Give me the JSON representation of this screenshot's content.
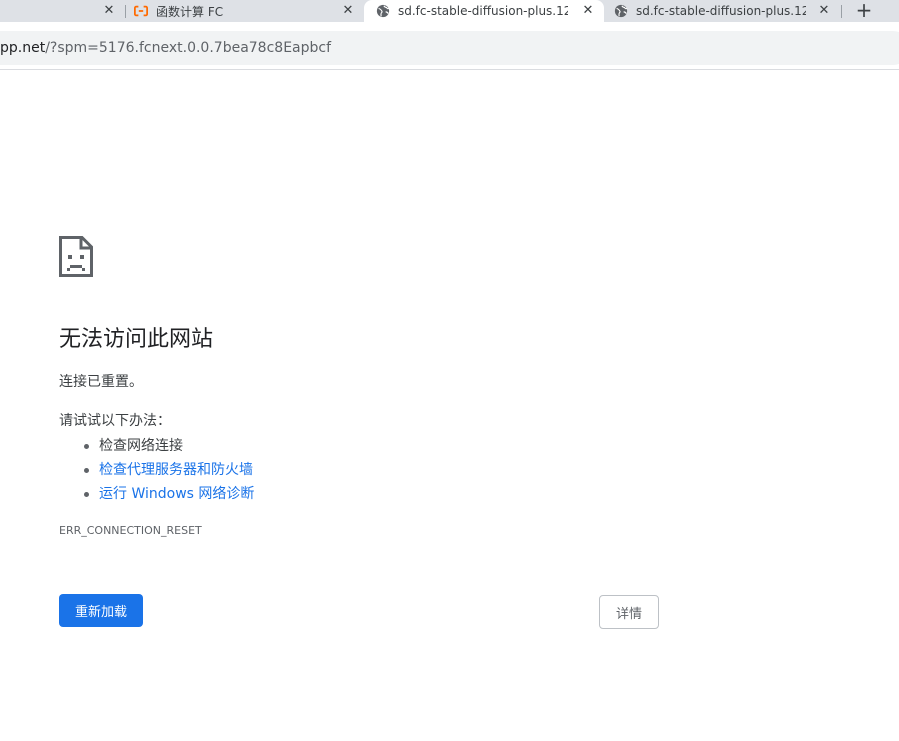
{
  "tabs": [
    {
      "title": "",
      "icon": "",
      "active": false
    },
    {
      "title": "函数计算 FC",
      "icon": "aliyun-logo-icon",
      "active": false
    },
    {
      "title": "sd.fc-stable-diffusion-plus.12",
      "icon": "globe-icon",
      "active": true
    },
    {
      "title": "sd.fc-stable-diffusion-plus.12",
      "icon": "globe-icon",
      "active": false
    }
  ],
  "tab_close_glyph": "✕",
  "new_tab_glyph": "+",
  "address_bar": {
    "host": "pp.net",
    "path": "/?spm=5176.fcnext.0.0.7bea78c8Eapbcf"
  },
  "error_page": {
    "icon": "sad-page-icon",
    "heading": "无法访问此网站",
    "summary": "连接已重置。",
    "suggestions_label": "请试试以下办法：",
    "suggestions": [
      {
        "text": "检查网络连接",
        "is_link": false
      },
      {
        "text": "检查代理服务器和防火墙",
        "is_link": true
      },
      {
        "text": "运行 Windows 网络诊断",
        "is_link": true
      }
    ],
    "error_code": "ERR_CONNECTION_RESET",
    "reload_label": "重新加载",
    "details_label": "详情"
  },
  "colors": {
    "accent": "#1a73e8",
    "tabstrip": "#dee1e6",
    "aliyun_orange": "#ff6a00"
  }
}
